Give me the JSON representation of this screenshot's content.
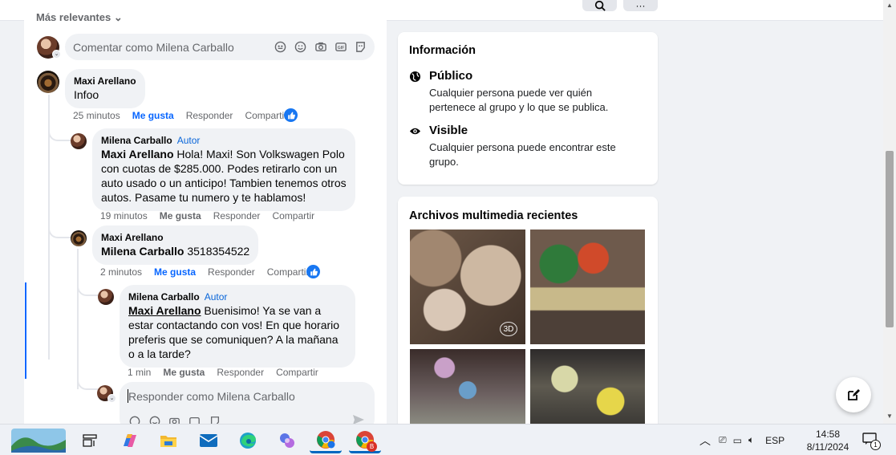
{
  "feed": {
    "sort_label": "Más relevantes ⌄",
    "comment_placeholder": "Comentar como Milena Carballo",
    "reply_placeholder": "Responder como Milena Carballo",
    "comments": [
      {
        "name": "Maxi Arellano",
        "text": "Infoo",
        "time": "25 minutos",
        "like": "Me gusta",
        "reply": "Responder",
        "share": "Compartir"
      },
      {
        "name": "Milena Carballo",
        "badge": "Autor",
        "mention": "Maxi Arellano",
        "text": " Hola! Maxi! Son Volkswagen Polo con cuotas de $285.000. Podes retirarlo con un auto usado o un anticipo! Tambien tenemos otros autos. Pasame tu numero y te hablamos!",
        "time": "19 minutos",
        "like": "Me gusta",
        "reply": "Responder",
        "share": "Compartir"
      },
      {
        "name": "Maxi Arellano",
        "mention": "Milena Carballo",
        "text": " 3518354522",
        "time": "2 minutos",
        "like": "Me gusta",
        "reply": "Responder",
        "share": "Compartir"
      },
      {
        "name": "Milena Carballo",
        "badge": "Autor",
        "mention": "Maxi Arellano",
        "text": " Buenisimo! Ya se van a estar contactando con vos! En que horario preferis que se comuniquen? A la mañana o a la tarde?",
        "time": "1 min",
        "like": "Me gusta",
        "reply": "Responder",
        "share": "Compartir"
      }
    ]
  },
  "info": {
    "title": "Información",
    "rows": [
      {
        "icon": "globe-icon",
        "title": "Público",
        "desc": "Cualquier persona puede ver quién pertenece al grupo y lo que se publica."
      },
      {
        "icon": "eye-icon",
        "title": "Visible",
        "desc": "Cualquier persona puede encontrar este grupo."
      }
    ]
  },
  "media": {
    "title": "Archivos multimedia recientes",
    "badge_3d": "3D"
  },
  "taskbar": {
    "lang": "ESP",
    "time": "14:58",
    "date": "8/11/2024",
    "notif_count": "1",
    "chrome_profile": "B"
  },
  "colors": {
    "accent": "#0866ff",
    "author_badge": "#0a66d9",
    "bubble": "#f0f2f5",
    "page_bg": "#f0f2f5"
  }
}
